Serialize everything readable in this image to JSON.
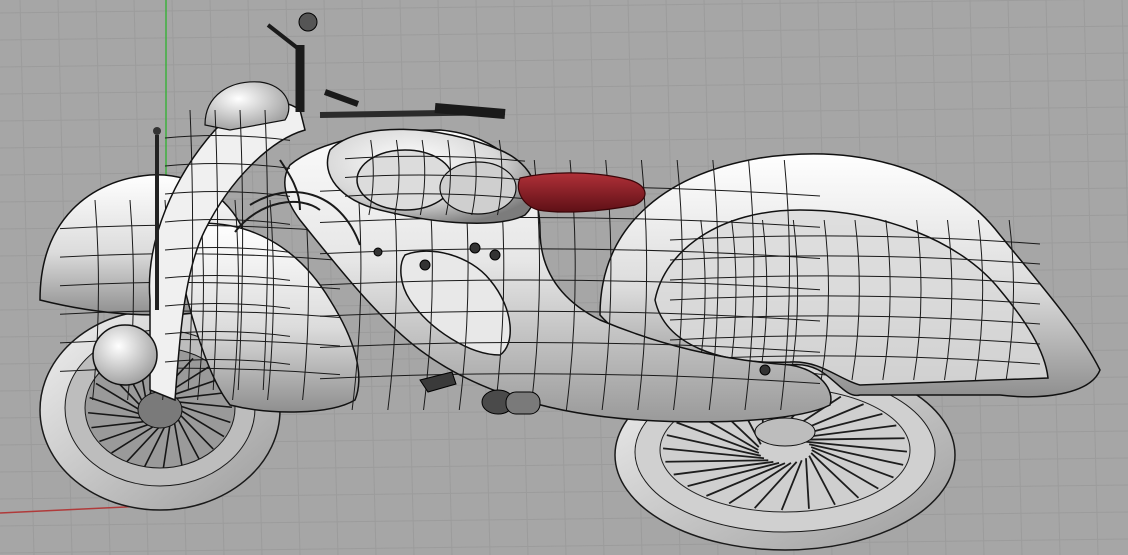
{
  "viewport": {
    "mode": "shaded-with-wireframe",
    "subject": "art-deco-motorcycle-model",
    "display_text": ""
  },
  "colors": {
    "background": "#a6a6a6",
    "grid_minor": "#9c9c9c",
    "grid_major": "#949494",
    "axis_y": "#3fb03f",
    "axis_x": "#b03a3a",
    "surface_light": "#f4f4f4",
    "surface_mid": "#cfcfcf",
    "surface_dark": "#8a8a8a",
    "isocurve": "#1a1a1a",
    "seat": "#8a1f22",
    "tire_dark": "#2a2a2a"
  },
  "icons": {
    "axis_y": "green-axis-line",
    "axis_x": "red-axis-line"
  }
}
